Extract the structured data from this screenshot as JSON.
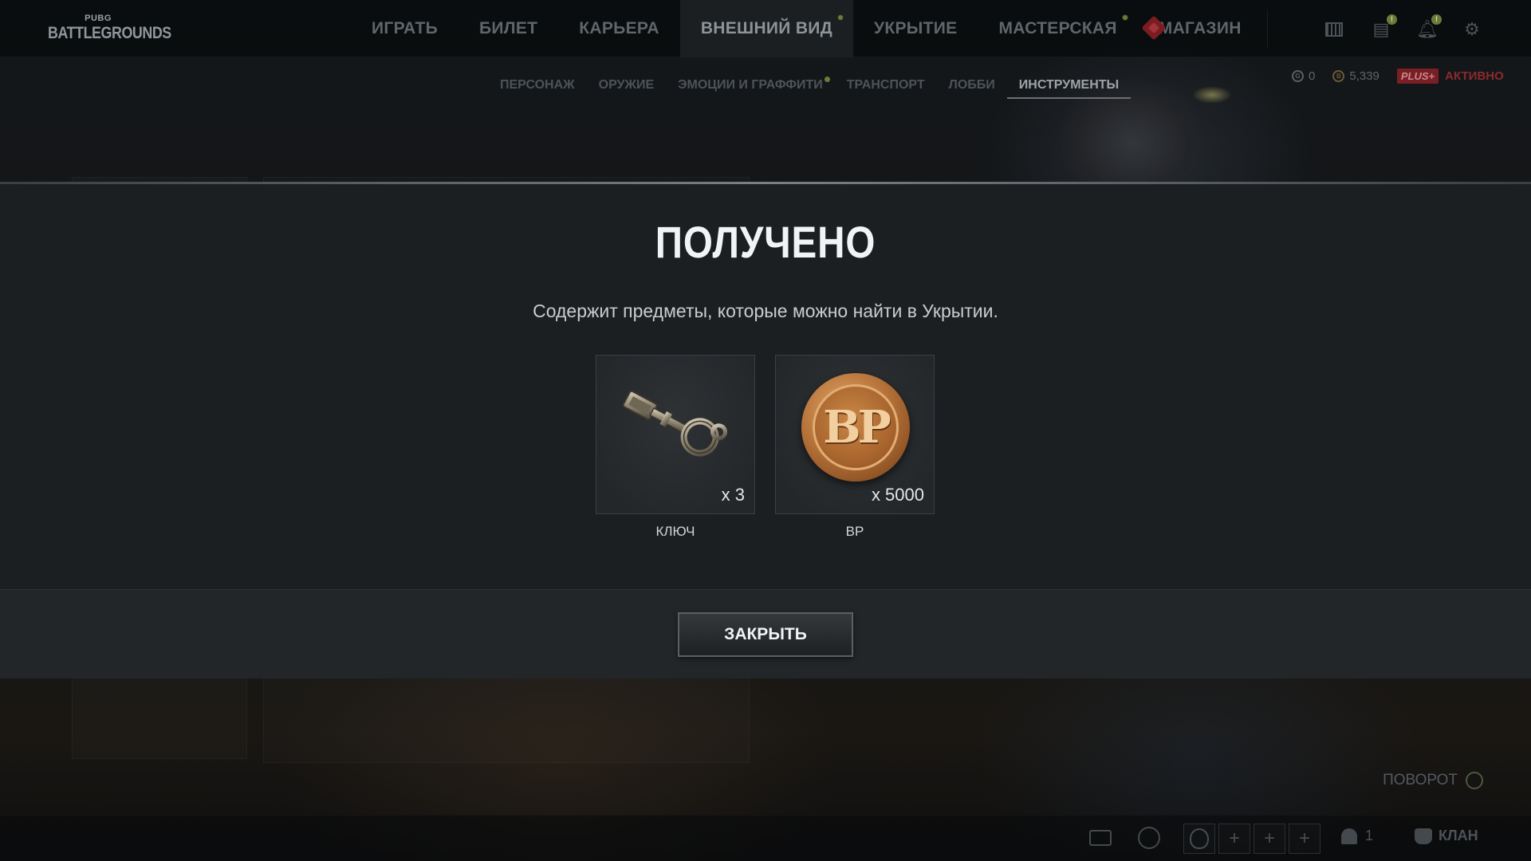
{
  "app": {
    "logo_small": "PUBG",
    "logo_big": "BATTLEGROUNDS"
  },
  "nav": {
    "items": [
      {
        "label": "ИГРАТЬ"
      },
      {
        "label": "БИЛЕТ"
      },
      {
        "label": "КАРЬЕРА"
      },
      {
        "label": "ВНЕШНИЙ ВИД",
        "active": true,
        "dot": true
      },
      {
        "label": "УКРЫТИЕ"
      },
      {
        "label": "МАСТЕРСКАЯ",
        "dot": true
      },
      {
        "label": "МАГАЗИН"
      }
    ],
    "icons": [
      "event-icon",
      "calendar-icon",
      "news-icon",
      "bell-icon",
      "gear-icon"
    ],
    "news_badge": "!",
    "bell_badge": "!"
  },
  "subnav": {
    "items": [
      {
        "label": "ПЕРСОНАЖ"
      },
      {
        "label": "ОРУЖИЕ"
      },
      {
        "label": "ЭМОЦИИ И ГРАФФИТИ",
        "dot": true
      },
      {
        "label": "ТРАНСПОРТ"
      },
      {
        "label": "ЛОББИ"
      },
      {
        "label": "ИНСТРУМЕНТЫ",
        "active": true
      }
    ]
  },
  "currency": {
    "g_coin": "0",
    "bp": "5,339",
    "plus_label": "PLUS+",
    "plus_status": "АКТИВНО"
  },
  "modal": {
    "title": "ПОЛУЧЕНО",
    "description": "Содержит предметы, которые можно найти в Укрытии.",
    "items": [
      {
        "name": "КЛЮЧ",
        "quantity": "x 3",
        "icon": "key-icon"
      },
      {
        "name": "BP",
        "quantity": "x 5000",
        "icon": "bp-coin-icon"
      }
    ],
    "close_label": "ЗАКРЫТЬ"
  },
  "rotate": {
    "label": "ПОВОРОТ"
  },
  "bottombar": {
    "party_count": "1",
    "clan_label": "КЛАН",
    "slot_plus": "+"
  },
  "colors": {
    "modal_bg": "#1b1f22",
    "footer_bg": "#222629",
    "accent_dot": "#6e7a3a",
    "plus_red": "#7a1f24",
    "bp_gold": "#b8743a"
  }
}
